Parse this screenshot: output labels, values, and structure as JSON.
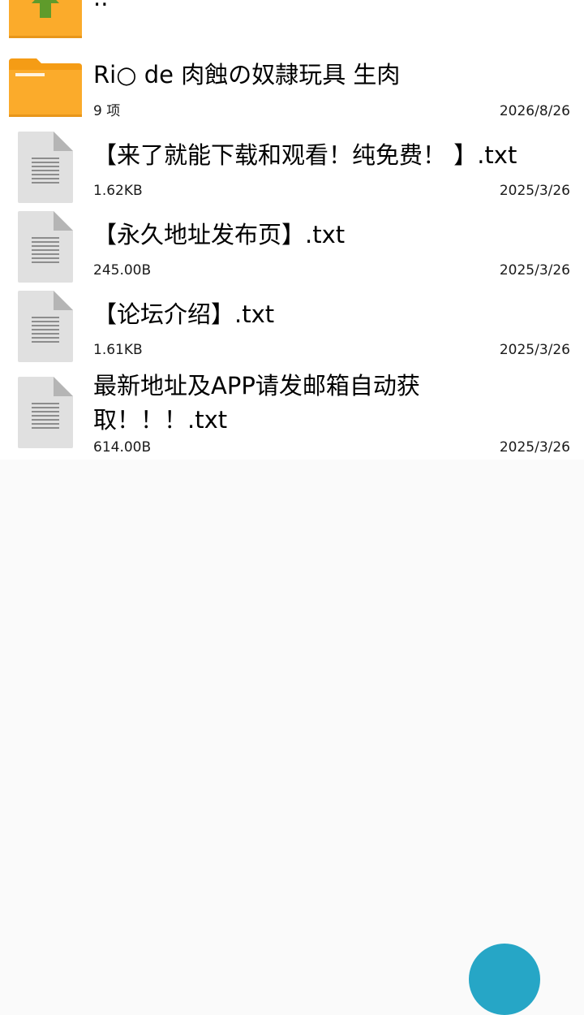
{
  "up_row": {
    "label": "..",
    "icon": "folder-up-icon"
  },
  "files": [
    {
      "type": "folder",
      "icon": "folder-icon",
      "name": "Ri○ de 肉蝕の奴隷玩具 生肉",
      "meta": "9 项",
      "date": "2026/8/26"
    },
    {
      "type": "file",
      "icon": "text-file-icon",
      "name": "【来了就能下载和观看！纯免费！ 】.txt",
      "meta": "1.62KB",
      "date": "2025/3/26"
    },
    {
      "type": "file",
      "icon": "text-file-icon",
      "name": "【永久地址发布页】.txt",
      "meta": "245.00B",
      "date": "2025/3/26"
    },
    {
      "type": "file",
      "icon": "text-file-icon",
      "name": "【论坛介绍】.txt",
      "meta": "1.61KB",
      "date": "2025/3/26"
    },
    {
      "type": "file",
      "icon": "text-file-icon",
      "name": "最新地址及APP请发邮箱自动获取！！！.txt",
      "meta": "614.00B",
      "date": "2025/3/26"
    }
  ],
  "colors": {
    "folder": "#fbab2b",
    "folder_tab": "#f59c15",
    "arrow": "#5f9b2b",
    "file_page": "#e0e0e0",
    "file_fold": "#b5b5b5",
    "fab": "#26a6c6"
  }
}
